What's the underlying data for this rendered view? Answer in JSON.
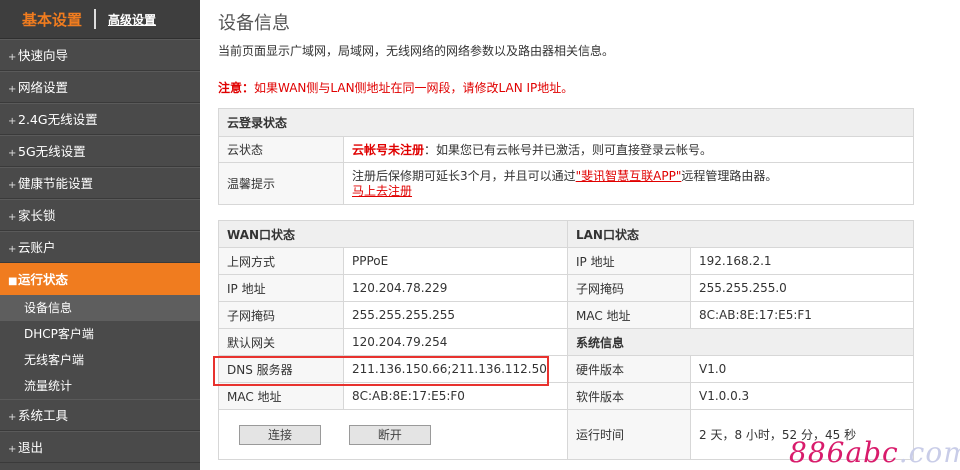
{
  "sidebar": {
    "tab_basic": "基本设置",
    "tab_advanced": "高级设置",
    "items": [
      {
        "label": "快速向导"
      },
      {
        "label": "网络设置"
      },
      {
        "label": "2.4G无线设置"
      },
      {
        "label": "5G无线设置"
      },
      {
        "label": "健康节能设置"
      },
      {
        "label": "家长锁"
      },
      {
        "label": "云账户"
      },
      {
        "label": "运行状态"
      }
    ],
    "subitems": [
      {
        "label": "设备信息"
      },
      {
        "label": "DHCP客户端"
      },
      {
        "label": "无线客户端"
      },
      {
        "label": "流量统计"
      }
    ],
    "items_after": [
      {
        "label": "系统工具"
      },
      {
        "label": "退出"
      }
    ]
  },
  "main": {
    "title": "设备信息",
    "description": "当前页面显示广域网，局域网，无线网络的网络参数以及路由器相关信息。",
    "notice_label": "注意：",
    "notice_text": "如果WAN侧与LAN侧地址在同一网段，请修改LAN IP地址。"
  },
  "cloud": {
    "header": "云登录状态",
    "status_label": "云状态",
    "status_red": "云帐号未注册",
    "status_text": "：如果您已有云帐号并已激活，则可直接登录云帐号。",
    "tip_label": "温馨提示",
    "tip_text_1": "注册后保修期可延长3个月，并且可以通过",
    "tip_link": "\"斐讯智慧互联APP\"",
    "tip_text_2": "远程管理路由器。",
    "register_link": "马上去注册"
  },
  "wan": {
    "header": "WAN口状态",
    "rows": [
      {
        "label": "上网方式",
        "value": "PPPoE"
      },
      {
        "label": "IP 地址",
        "value": "120.204.78.229"
      },
      {
        "label": "子网掩码",
        "value": "255.255.255.255"
      },
      {
        "label": "默认网关",
        "value": "120.204.79.254"
      },
      {
        "label": "DNS 服务器",
        "value": "211.136.150.66;211.136.112.50"
      },
      {
        "label": "MAC 地址",
        "value": "8C:AB:8E:17:E5:F0"
      }
    ],
    "connect_button": "连接",
    "disconnect_button": "断开"
  },
  "lan": {
    "header": "LAN口状态",
    "rows": [
      {
        "label": "IP 地址",
        "value": "192.168.2.1"
      },
      {
        "label": "子网掩码",
        "value": "255.255.255.0"
      },
      {
        "label": "MAC 地址",
        "value": "8C:AB:8E:17:E5:F1"
      }
    ]
  },
  "system": {
    "header": "系统信息",
    "rows": [
      {
        "label": "硬件版本",
        "value": "V1.0"
      },
      {
        "label": "软件版本",
        "value": "V1.0.0.3"
      },
      {
        "label": "运行时间",
        "value": "2 天，8 小时，52 分，45 秒"
      }
    ]
  },
  "watermark": {
    "main": "886abc",
    "faded": ".com"
  }
}
